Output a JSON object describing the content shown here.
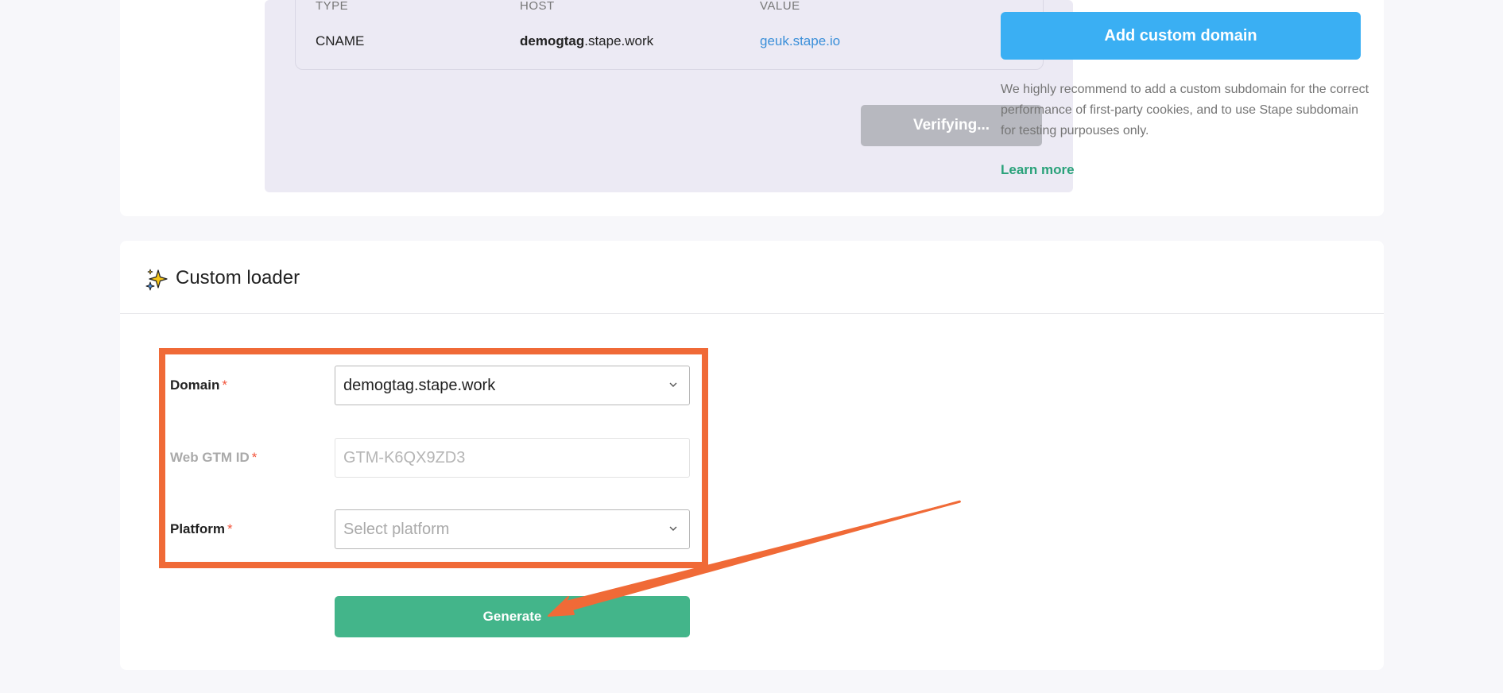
{
  "dns": {
    "headers": [
      "TYPE",
      "HOST",
      "VALUE"
    ],
    "row": {
      "type": "CNAME",
      "host_bold": "demogtag",
      "host_rest": ".stape.work",
      "value": "geuk.stape.io"
    },
    "verify_label": "Verifying..."
  },
  "sidebar": {
    "add_domain_label": "Add custom domain",
    "recommend_text": "We highly recommend to add a custom subdomain for the correct performance of first-party cookies, and to use Stape subdomain for testing purpouses only.",
    "learn_more": "Learn more"
  },
  "custom_loader": {
    "title": "Custom loader",
    "domain_label": "Domain",
    "domain_value": "demogtag.stape.work",
    "gtm_label": "Web GTM ID",
    "gtm_placeholder": "GTM-K6QX9ZD3",
    "platform_label": "Platform",
    "platform_placeholder": "Select platform",
    "required_mark": "*",
    "generate_label": "Generate"
  },
  "colors": {
    "primary_blue": "#3aaff3",
    "green": "#43b58a",
    "annotation_orange": "#f06a37",
    "disabled_gray": "#b7b8bf"
  },
  "icons": [
    "sparkle-icon",
    "chevron-down-icon"
  ]
}
